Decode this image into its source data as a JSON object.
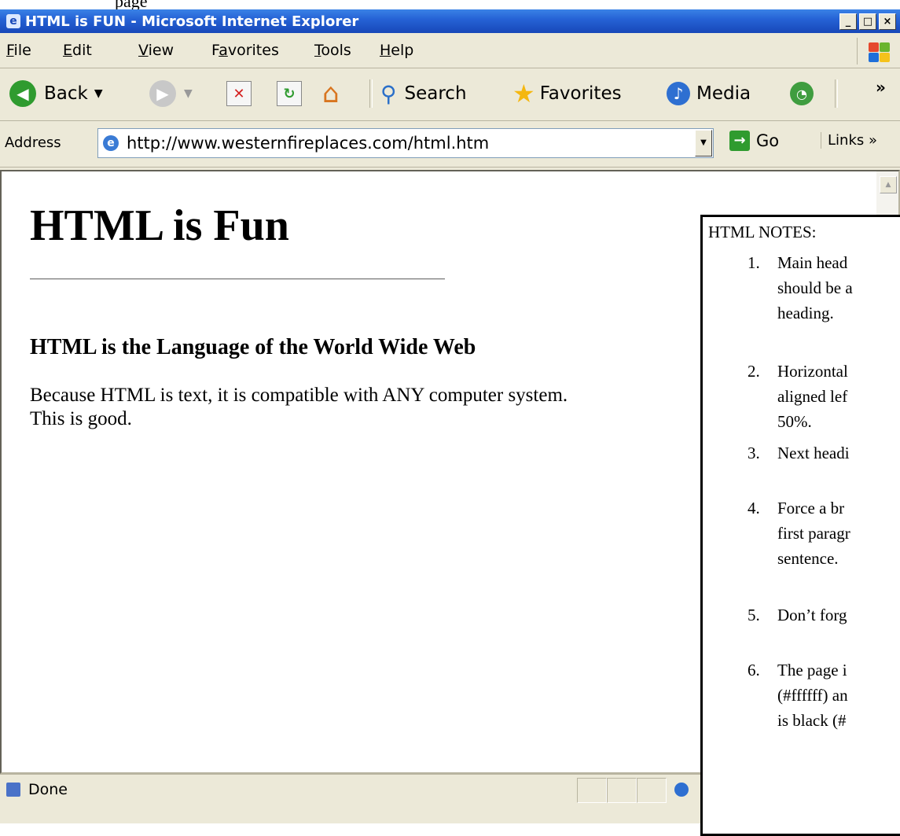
{
  "window": {
    "title": "HTML is FUN - Microsoft Internet Explorer",
    "controls": [
      "_",
      "□",
      "×"
    ]
  },
  "above_window_text": "page",
  "menu": {
    "items": [
      {
        "label": "File",
        "underline": "F",
        "rest": "ile"
      },
      {
        "label": "Edit",
        "underline": "E",
        "rest": "dit"
      },
      {
        "label": "View",
        "underline": "V",
        "rest": "iew"
      },
      {
        "label": "Favorites",
        "underline": "a",
        "before": "F",
        "rest": "vorites"
      },
      {
        "label": "Tools",
        "underline": "T",
        "rest": "ools"
      },
      {
        "label": "Help",
        "underline": "H",
        "rest": "elp"
      }
    ]
  },
  "toolbar": {
    "back_label": "Back",
    "search_label": "Search",
    "favorites_label": "Favorites",
    "media_label": "Media",
    "more_label": "»"
  },
  "address": {
    "label": "Address",
    "url": "http://www.westernfireplaces.com/html.htm",
    "go_label": "Go",
    "links_label": "Links »"
  },
  "page": {
    "heading": "HTML is Fun",
    "subheading": "HTML is the Language of the World Wide Web",
    "paragraph_line1": "Because HTML is text, it is compatible with ANY computer system.",
    "paragraph_line2": "This is good."
  },
  "status": {
    "text": "Done"
  },
  "notes": {
    "title": "HTML NOTES:",
    "items": [
      {
        "num": "1.",
        "lines": [
          "Main head",
          "should be a",
          "heading."
        ]
      },
      {
        "num": "2.",
        "lines": [
          "Horizontal",
          "aligned lef",
          "50%."
        ]
      },
      {
        "num": "3.",
        "lines": [
          "Next headi"
        ]
      },
      {
        "num": "4.",
        "lines": [
          "Force a  br",
          "first paragr",
          "sentence."
        ]
      },
      {
        "num": "5.",
        "lines": [
          "Don’t forg"
        ]
      },
      {
        "num": "6.",
        "lines": [
          "The page i",
          "(#ffffff) an",
          "is black (#"
        ]
      }
    ]
  },
  "colors": {
    "title_bar": "#2663d6",
    "chrome": "#ece9d8",
    "page_background": "#ffffff"
  }
}
